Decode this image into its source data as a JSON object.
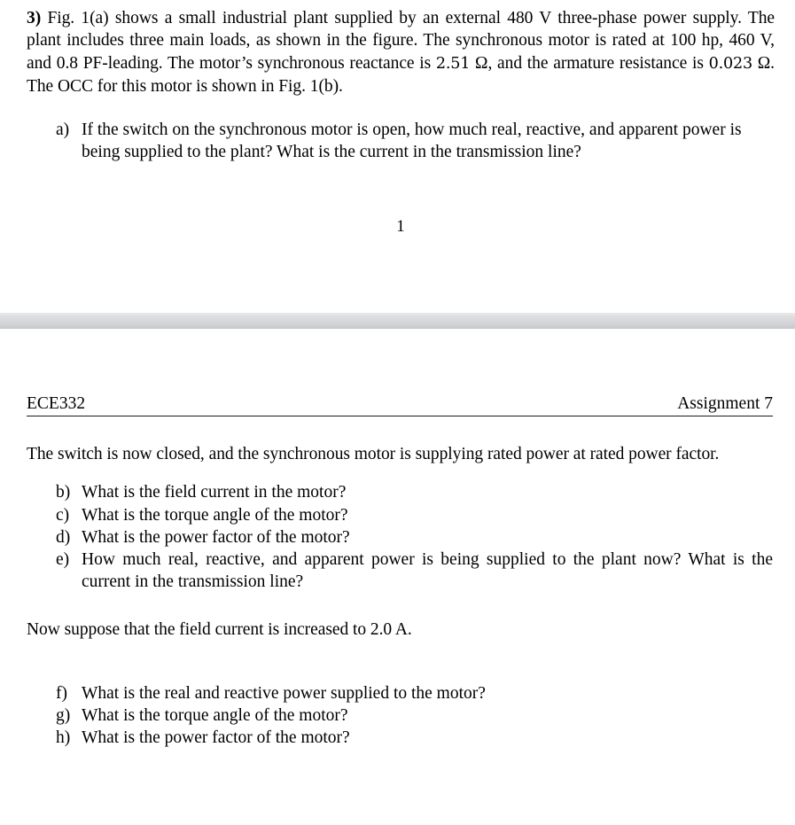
{
  "document": {
    "header": {
      "course_code": "ECE332",
      "assignment_label": "Assignment 7"
    },
    "page_one": {
      "page_number": "1",
      "problem": {
        "number": "3)",
        "text_part_1": " Fig. 1(a) shows a small industrial plant supplied by an external 480 V three-phase power supply. The plant includes three main loads, as shown in the figure. The synchronous motor is rated at 100 hp, 460 V, and 0.8 PF-leading. The motor’s synchronous reactance is ",
        "reactance_value": "2.51",
        "text_part_2": " Ω, and the armature resistance is ",
        "resistance_value": "0.023",
        "text_part_3": " Ω. The OCC for this motor is shown in Fig. 1(b)."
      },
      "questions": [
        {
          "marker": "a)",
          "text": "If the switch on the synchronous motor is open, how much real, reactive, and apparent power is being supplied to the plant? What is the current in the transmission line?"
        }
      ]
    },
    "page_two": {
      "intro_paragraph": "The switch is now closed, and the synchronous motor is supplying rated power at rated power factor.",
      "questions_group_1": [
        {
          "marker": "b)",
          "text": "What is the field current in the motor?"
        },
        {
          "marker": "c)",
          "text": "What is the torque angle of the motor?"
        },
        {
          "marker": "d)",
          "text": "What is the power factor of the motor?"
        },
        {
          "marker": "e)",
          "text": "How much real, reactive, and apparent power is being supplied to the plant now? What is the current in the transmission line?"
        }
      ],
      "second_paragraph": "Now suppose that the field current is increased to 2.0 A.",
      "questions_group_2": [
        {
          "marker": "f)",
          "text": "What is the real and reactive power supplied to the motor?"
        },
        {
          "marker": "g)",
          "text": "What is the torque angle of the motor?"
        },
        {
          "marker": "h)",
          "text": "What is the power factor of the motor?"
        }
      ]
    }
  },
  "colors": {
    "page_background": "#ffffff",
    "text": "#000000",
    "page_gap": "#dcdde0"
  }
}
